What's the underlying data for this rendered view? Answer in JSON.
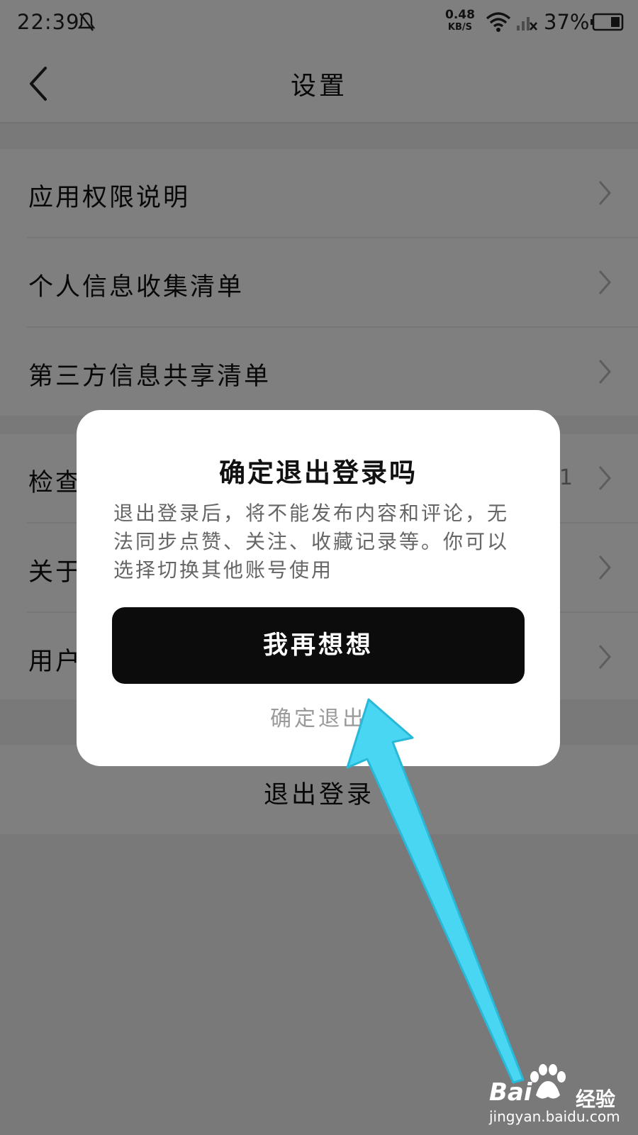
{
  "status_bar": {
    "time": "22:39",
    "net_speed_value": "0.48",
    "net_speed_unit": "KB/S",
    "battery": "37%"
  },
  "header": {
    "title": "设置"
  },
  "settings": {
    "items": [
      {
        "label": "应用权限说明",
        "value": ""
      },
      {
        "label": "个人信息收集清单",
        "value": ""
      },
      {
        "label": "第三方信息共享清单",
        "value": ""
      },
      {
        "label": "检查",
        "value": "1"
      },
      {
        "label": "关于",
        "value": ""
      },
      {
        "label": "用户",
        "value": ""
      }
    ],
    "logout_label": "退出登录"
  },
  "dialog": {
    "title": "确定退出登录吗",
    "message": "退出登录后，将不能发布内容和评论，无法同步点赞、关注、收藏记录等。你可以选择切换其他账号使用",
    "primary_button": "我再想想",
    "secondary_button": "确定退出"
  },
  "annotation": {
    "arrow_color": "#48d6f2"
  },
  "watermark": {
    "brand": "Bai",
    "cn": "经验",
    "url": "jingyan.baidu.com"
  },
  "colors": {
    "overlay": "rgba(0,0,0,0.5)",
    "primary_button_bg": "#0c0c0c"
  }
}
